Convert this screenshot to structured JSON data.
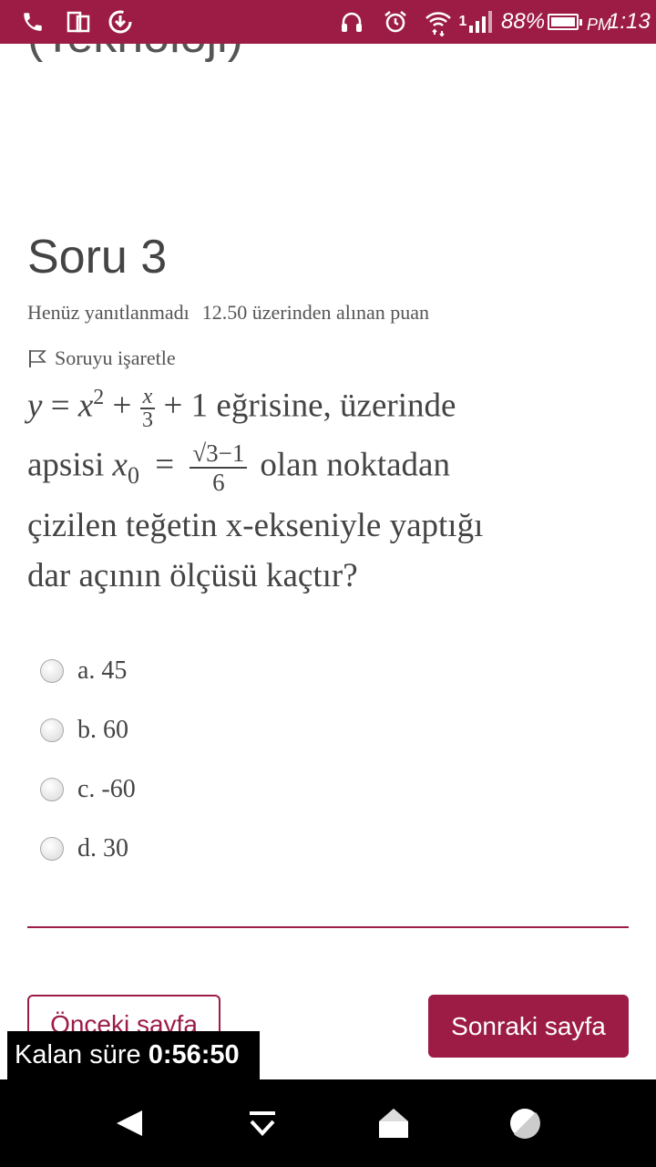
{
  "status_bar": {
    "battery": "88%",
    "time_period": "PM",
    "time": "1:13",
    "signal_label": "1",
    "icons": [
      "phone-icon",
      "screen-mirror-icon",
      "download-icon",
      "headset-icon",
      "alarm-icon",
      "wifi-icon",
      "signal-icon",
      "battery-icon"
    ]
  },
  "header_clipped": "(Teknoloji)",
  "question": {
    "title": "Soru 3",
    "status": "Henüz yanıtlanmadı",
    "points": "12.50 üzerinden alınan puan",
    "flag_label": "Soruyu işaretle",
    "line1": {
      "y": "y",
      "eq": " = ",
      "x": "x",
      "exp": "2",
      "plus1": " + ",
      "frac_num": "x",
      "frac_den": "3",
      "plus2": " + 1 ",
      "text": "eğrisine, üzerinde"
    },
    "line2": {
      "text1": "apsisi ",
      "x0": "x",
      "sub": "0",
      "eq": " = ",
      "frac_num": "√3−1",
      "frac_den": "6",
      "text2": "olan noktadan"
    },
    "line3": "çizilen teğetin x-ekseniyle yaptığı",
    "line4": "dar açının ölçüsü kaçtır?"
  },
  "options": [
    {
      "label": "a. 45"
    },
    {
      "label": "b. 60"
    },
    {
      "label": "c. -60"
    },
    {
      "label": "d. 30"
    }
  ],
  "nav": {
    "prev_label": "Önceki sayfa",
    "next_label": "Sonraki sayfa"
  },
  "timer": {
    "label": "Kalan süre",
    "value": "0:56:50"
  },
  "android_nav": {
    "icons": [
      "back-icon",
      "menu-down-icon",
      "home-icon",
      "recents-icon"
    ]
  },
  "colors": {
    "accent": "#9c1c46",
    "text": "#444444"
  }
}
